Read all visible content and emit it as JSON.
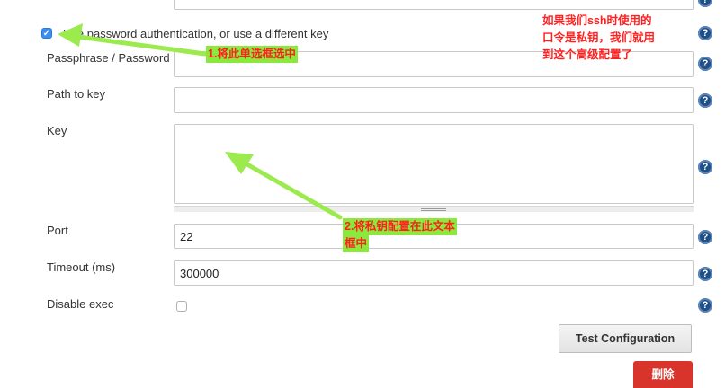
{
  "form": {
    "use_password_checkbox": {
      "label": "Use password authentication, or use a different key",
      "checked": true
    },
    "passphrase": {
      "label": "Passphrase / Password",
      "value": ""
    },
    "path_to_key": {
      "label": "Path to key",
      "value": ""
    },
    "key": {
      "label": "Key",
      "value": ""
    },
    "port": {
      "label": "Port",
      "value": "22"
    },
    "timeout": {
      "label": "Timeout (ms)",
      "value": "300000"
    },
    "disable_exec": {
      "label": "Disable exec",
      "checked": false
    },
    "test_button_label": "Test Configuration",
    "delete_button_label": "删除",
    "help_icon_glyph": "?"
  },
  "annotations": {
    "note_top_right": [
      "如果我们ssh时使用的",
      "口令是私钥，我们就用",
      "到这个高级配置了"
    ],
    "note_step1": "1.将此单选框选中",
    "note_step2": [
      "2.将私钥配置在此文本",
      "框中"
    ]
  },
  "colors": {
    "annotation_text": "#ff1f1f",
    "annotation_highlight": "#8be83d",
    "help_icon": "#1f4f86",
    "checkbox_checked": "#3b8ff3",
    "delete_button": "#d9342b"
  }
}
